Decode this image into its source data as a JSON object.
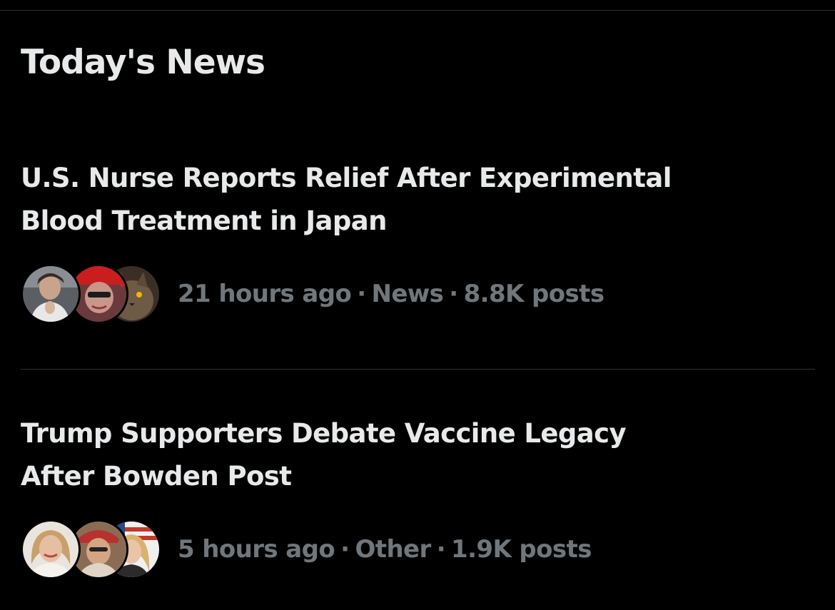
{
  "section": {
    "title": "Today's News"
  },
  "news": [
    {
      "headline_line1": "U.S. Nurse Reports Relief After Experimental",
      "headline_line2": "Blood Treatment in Japan",
      "time": "21 hours ago",
      "category": "News",
      "posts": "8.8K posts",
      "separator": "·",
      "avatar_icons": [
        "woman-praying-avatar-icon",
        "woman-red-hat-avatar-icon",
        "cat-avatar-icon"
      ]
    },
    {
      "headline_line1": "Trump Supporters Debate Vaccine Legacy",
      "headline_line2": "After Bowden Post",
      "time": "5 hours ago",
      "category": "Other",
      "posts": "1.9K posts",
      "separator": "·",
      "avatar_icons": [
        "blonde-woman-avatar-icon",
        "man-red-hat-avatar-icon",
        "woman-flag-avatar-icon"
      ]
    }
  ],
  "colors": {
    "background": "#000000",
    "headline": "#e7e9ea",
    "meta": "#71767b",
    "divider": "#2f3336"
  }
}
